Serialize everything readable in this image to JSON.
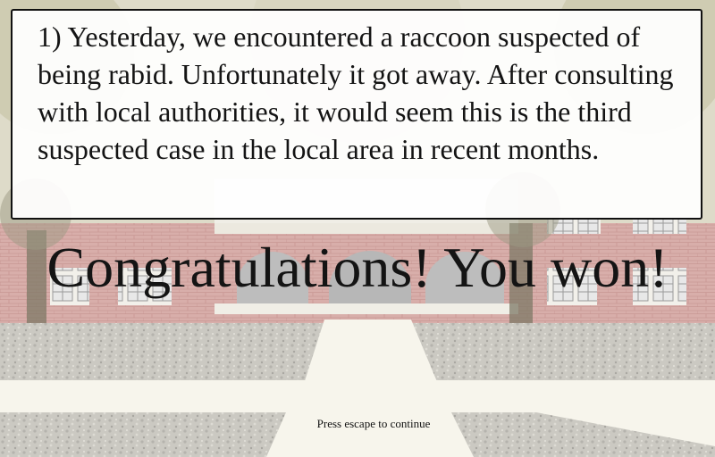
{
  "dialog": {
    "text": "1) Yesterday, we encountered a raccoon suspected of being rabid. Unfortunately it got away. After consulting with local authorities, it would seem this is the third suspected case in the local area in recent months."
  },
  "banner": {
    "text": "Congratulations! You won!"
  },
  "hint": {
    "text": "Press escape to continue"
  },
  "colors": {
    "text": "#141414",
    "dialog_bg": "#ffffff",
    "dialog_border": "#111111",
    "brick": "#d4a9a4",
    "path": "#f7f5ec",
    "gravel": "#c9c7c0"
  }
}
